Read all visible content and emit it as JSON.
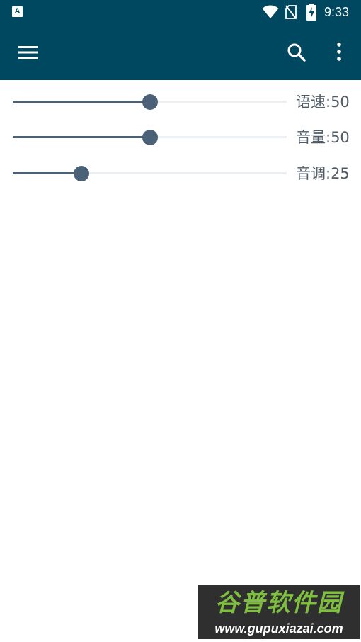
{
  "status_bar": {
    "app_icon_letter": "A",
    "time": "9:33",
    "icons": [
      "wifi-icon",
      "no-sim-icon",
      "battery-charging-icon"
    ]
  },
  "toolbar": {
    "menu_icon": "menu-icon",
    "search_icon": "search-icon",
    "more_icon": "more-vert-icon"
  },
  "sliders": [
    {
      "label": "语速:50",
      "value": 50,
      "max": 100
    },
    {
      "label": "音量:50",
      "value": 50,
      "max": 100
    },
    {
      "label": "音调:25",
      "value": 25,
      "max": 100
    }
  ],
  "colors": {
    "app_bar": "#00485f",
    "slider_active": "#4a6178",
    "slider_track": "#eceff1",
    "label_text": "#4f5b66"
  },
  "watermark": {
    "title": "谷普软件园",
    "url": "www.gupuxiazai.com"
  }
}
